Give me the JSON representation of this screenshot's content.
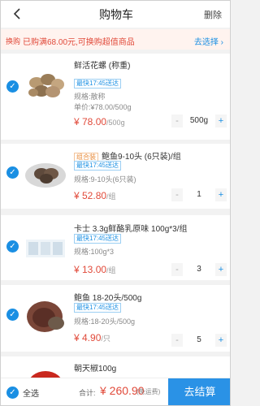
{
  "header": {
    "title": "购物车",
    "delete_label": "删除"
  },
  "promo": {
    "tag": "换购",
    "text": "已购满68.00元,可换购超值商品",
    "link": "去选择 ›"
  },
  "items": [
    {
      "name": "鲜活花螺 (称重)",
      "delivery": "最快17:45送达",
      "spec": "规格:散称",
      "unitprice": "单价:¥78.00/500g",
      "price": "¥ 78.00",
      "price_unit": "/500g",
      "qty": "500g"
    },
    {
      "combo": "组合装",
      "name": "鲍鱼9-10头 (6只装)/组",
      "delivery": "最快17:45送达",
      "spec": "规格:9-10头(6只装)",
      "price": "¥ 52.80",
      "price_unit": "/组",
      "qty": "1"
    },
    {
      "name": "卡士 3.3g鲜酪乳原味 100g*3/组",
      "delivery": "最快17:45送达",
      "spec": "规格:100g*3",
      "price": "¥ 13.00",
      "price_unit": "/组",
      "qty": "3"
    },
    {
      "name": "鲍鱼 18-20头/500g",
      "delivery": "最快17:45送达",
      "spec": "规格:18-20头/500g",
      "price": "¥ 4.90",
      "price_unit": "/只",
      "qty": "5"
    },
    {
      "name": "朝天椒100g"
    }
  ],
  "footer": {
    "select_all": "全选",
    "total_label": "合计:",
    "total": "¥ 260.90",
    "no_fee": "(免运费)",
    "checkout": "去结算"
  },
  "stepper": {
    "minus": "-",
    "plus": "+"
  },
  "check_mark": "✓"
}
